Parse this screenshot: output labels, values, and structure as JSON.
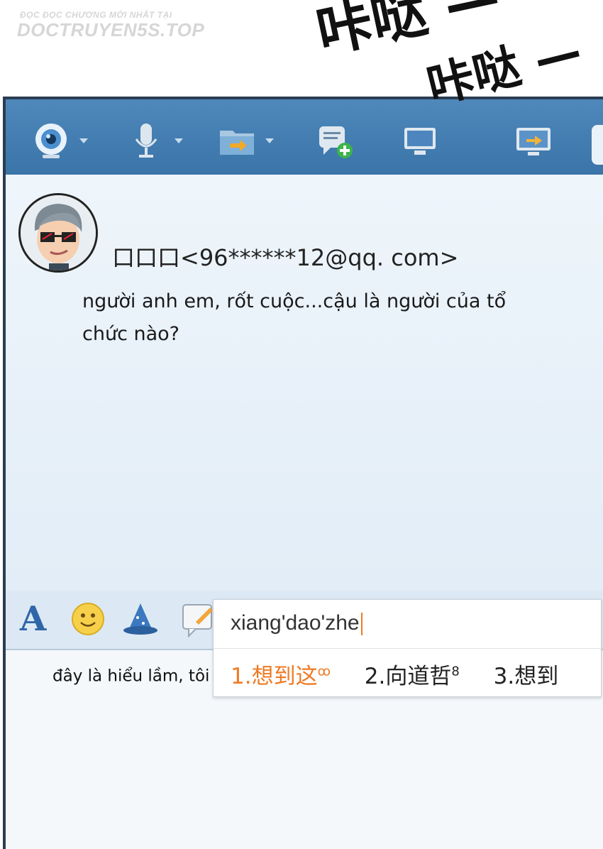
{
  "watermark": {
    "line1": "ĐỌC ĐỌC CHƯƠNG MỚI NHẤT TẠI",
    "line2": "DOCTRUYEN5S.TOP"
  },
  "sfx": {
    "first": "咔哒 —",
    "second": "咔哒 —"
  },
  "toolbar": {
    "icons": [
      "webcam-icon",
      "microphone-icon",
      "folder-transfer-icon",
      "message-add-icon",
      "remote-desktop-icon",
      "screen-share-icon"
    ]
  },
  "chat": {
    "sender": "口口口<96******12@qq. com>",
    "message": "người anh em, rốt cuộc...cậu là người của tổ chức nào?"
  },
  "format_toolbar": {
    "icons": [
      "font-icon",
      "emoji-icon",
      "magic-icon",
      "note-icon",
      "image-icon",
      "document-icon",
      "music-icon",
      "screenshot-icon",
      "more-icon"
    ]
  },
  "input": {
    "text": "đây là hiểu lầm, tôi cũng không"
  },
  "ime": {
    "composition": "xiang'dao'zhe",
    "candidates": [
      {
        "label": "1.想到这",
        "mark": "ꝏ"
      },
      {
        "label": "2.向道哲",
        "mark": "8"
      },
      {
        "label": "3.想到",
        "mark": ""
      }
    ]
  },
  "colors": {
    "toolbar": "#3f79ad",
    "chat_bg": "#e6f0f8",
    "ime_highlight": "#ef7a24"
  }
}
